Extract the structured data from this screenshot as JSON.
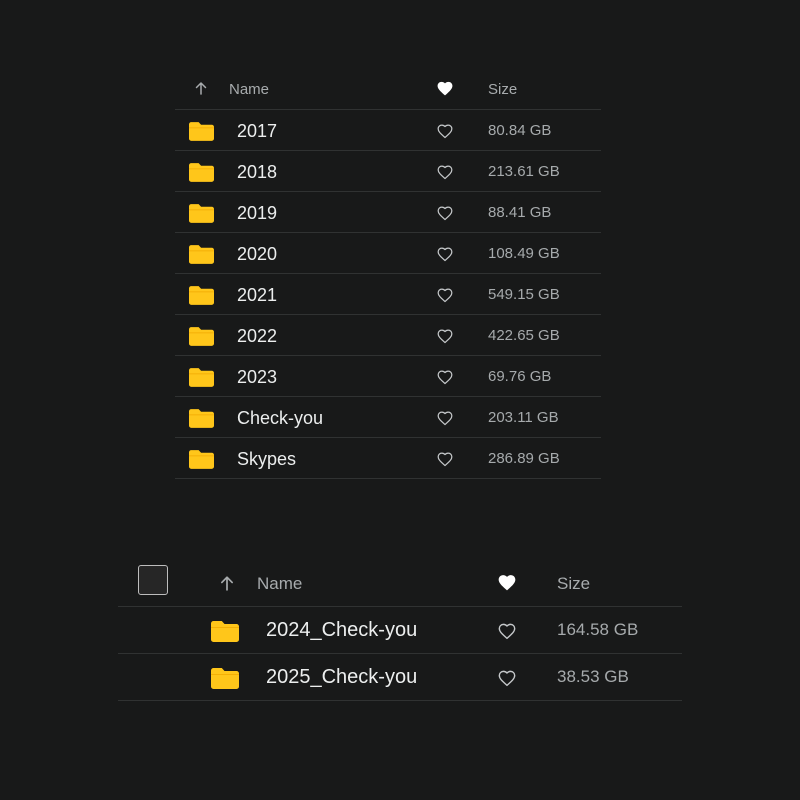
{
  "colors": {
    "background": "#181919",
    "folder": "#ffc61a",
    "text_primary": "#eceeee",
    "text_secondary": "#a7abad",
    "divider": "#303232"
  },
  "list1": {
    "header": {
      "name_label": "Name",
      "size_label": "Size",
      "sort_icon": "arrow-up-icon",
      "favorite_icon": "heart-filled-icon"
    },
    "rows": [
      {
        "name": "2017",
        "size": "80.84 GB"
      },
      {
        "name": "2018",
        "size": "213.61 GB"
      },
      {
        "name": "2019",
        "size": "88.41 GB"
      },
      {
        "name": "2020",
        "size": "108.49 GB"
      },
      {
        "name": "2021",
        "size": "549.15 GB"
      },
      {
        "name": "2022",
        "size": "422.65 GB"
      },
      {
        "name": "2023",
        "size": "69.76 GB"
      },
      {
        "name": "Check-you",
        "size": "203.11 GB"
      },
      {
        "name": "Skypes",
        "size": "286.89 GB"
      }
    ]
  },
  "list2": {
    "header": {
      "name_label": "Name",
      "size_label": "Size",
      "sort_icon": "arrow-up-icon",
      "favorite_icon": "heart-filled-icon",
      "select_all_checked": false
    },
    "rows": [
      {
        "name": "2024_Check-you",
        "size": "164.58 GB"
      },
      {
        "name": "2025_Check-you",
        "size": "38.53 GB"
      }
    ]
  }
}
